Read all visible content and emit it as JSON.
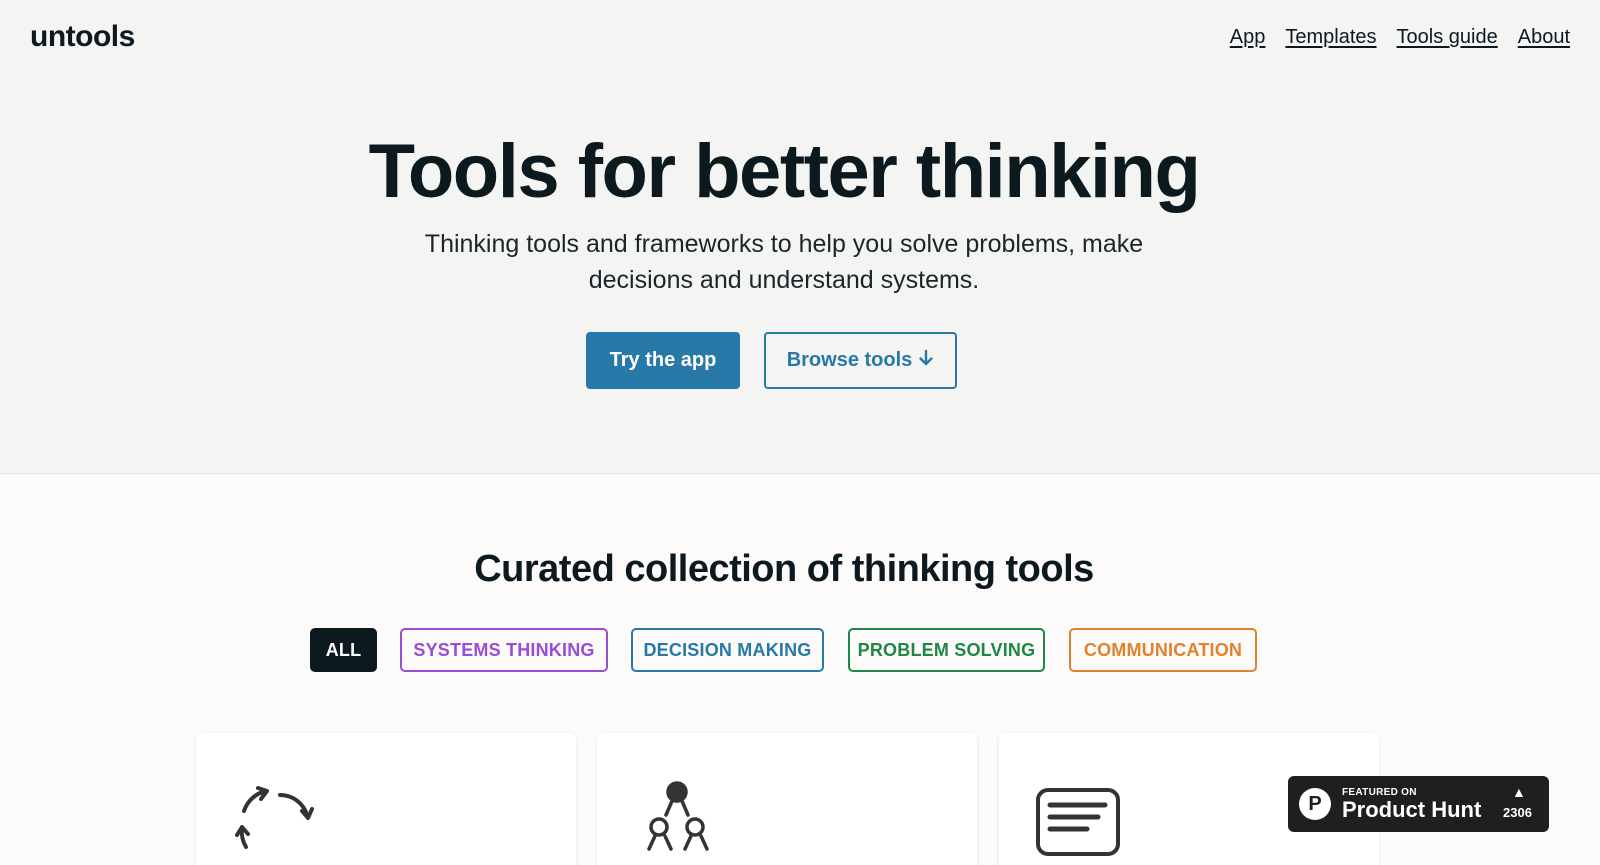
{
  "header": {
    "logo": "untools",
    "nav": [
      {
        "label": "App"
      },
      {
        "label": "Templates"
      },
      {
        "label": "Tools guide"
      },
      {
        "label": "About"
      }
    ]
  },
  "hero": {
    "title": "Tools for better thinking",
    "subtitle": "Thinking tools and frameworks to help you solve problems, make decisions and understand systems.",
    "primary_button": "Try the app",
    "secondary_button": "Browse tools",
    "secondary_button_icon": "arrow-down-icon"
  },
  "collection": {
    "title": "Curated collection of thinking tools",
    "filters": [
      {
        "label": "ALL",
        "color": "#0c1a20"
      },
      {
        "label": "SYSTEMS THINKING",
        "color": "#9a4cd6"
      },
      {
        "label": "DECISION MAKING",
        "color": "#2878a8"
      },
      {
        "label": "PROBLEM SOLVING",
        "color": "#1e8748"
      },
      {
        "label": "COMMUNICATION",
        "color": "#e0822e"
      }
    ],
    "cards": [
      {
        "icon": "cycle-arrows-icon"
      },
      {
        "icon": "decision-tree-icon"
      },
      {
        "icon": "speech-bubble-icon"
      }
    ]
  },
  "product_hunt_badge": {
    "small_text": "FEATURED ON",
    "big_text": "Product Hunt",
    "logo_letter": "P",
    "votes": "2306",
    "arrow": "▲"
  },
  "colors": {
    "accent": "#2878a8",
    "hero_bg": "#f4f4f2",
    "text": "#0c1a20"
  }
}
